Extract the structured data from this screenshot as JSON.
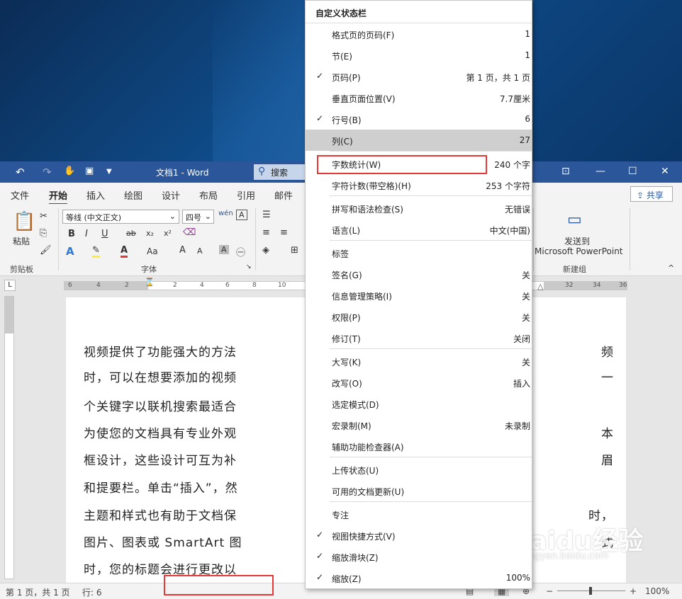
{
  "titlebar": {
    "undo_icon": "undo-icon",
    "redo_icon": "redo-icon",
    "title": "文档1 - Word",
    "search": "搜索"
  },
  "tabs": [
    "文件",
    "开始",
    "插入",
    "绘图",
    "设计",
    "布局",
    "引用",
    "邮件"
  ],
  "share_label": "共享",
  "ribbon": {
    "paste": "粘贴",
    "clipboard": "剪贴板",
    "font_name": "等线 (中文正文)",
    "font_size": "四号",
    "font_group": "字体",
    "bold": "B",
    "italic": "I",
    "underline": "U",
    "strike": "ab",
    "sub": "x₂",
    "sup": "x²",
    "aa": "Aa",
    "grow": "A^",
    "shrink": "A˅",
    "send_line1": "发送到",
    "send_line2": "Microsoft PowerPoint",
    "new_group": "新建组"
  },
  "ruler": {
    "left": [
      "6",
      "4",
      "2"
    ],
    "mid": [
      "2",
      "4",
      "6",
      "8",
      "10"
    ],
    "right": [
      "32",
      "34",
      "36"
    ],
    "corner": "L"
  },
  "document": {
    "lines": [
      "视频提供了功能强大的方法",
      "时，可以在想要添加的视频",
      "个关键字以联机搜索最适合",
      "为使您的文档具有专业外观",
      "框设计，这些设计可互为补",
      "和提要栏。单击“插入”，然",
      "主题和样式也有助于文档保",
      "图片、图表或 SmartArt 图",
      "时，您的标题会进行更改以"
    ],
    "right_frags": [
      "频",
      "一",
      "",
      "本",
      "眉",
      "",
      "时，",
      "式",
      ""
    ]
  },
  "status": {
    "page": "第 1 页，共 1 页",
    "line": "行: 6",
    "zoom": "100%",
    "minus": "−",
    "plus": "+"
  },
  "menu": {
    "title": "自定义状态栏",
    "items": [
      {
        "label": "格式页的页码(F)",
        "value": "1",
        "checked": ""
      },
      {
        "label": "节(E)",
        "value": "1",
        "checked": ""
      },
      {
        "label": "页码(P)",
        "value": "第 1 页，共 1 页",
        "checked": "✓"
      },
      {
        "label": "垂直页面位置(V)",
        "value": "7.7厘米",
        "checked": ""
      },
      {
        "label": "行号(B)",
        "value": "6",
        "checked": "✓"
      },
      {
        "label": "列(C)",
        "value": "27",
        "checked": ""
      },
      {
        "label": "字数统计(W)",
        "value": "240 个字",
        "checked": ""
      },
      {
        "label": "字符计数(带空格)(H)",
        "value": "253 个字符",
        "checked": ""
      },
      {
        "label": "拼写和语法检查(S)",
        "value": "无错误",
        "checked": ""
      },
      {
        "label": "语言(L)",
        "value": "中文(中国)",
        "checked": ""
      },
      {
        "label": "标签",
        "value": "",
        "checked": ""
      },
      {
        "label": "签名(G)",
        "value": "关",
        "checked": ""
      },
      {
        "label": "信息管理策略(I)",
        "value": "关",
        "checked": ""
      },
      {
        "label": "权限(P)",
        "value": "关",
        "checked": ""
      },
      {
        "label": "修订(T)",
        "value": "关闭",
        "checked": ""
      },
      {
        "label": "大写(K)",
        "value": "关",
        "checked": ""
      },
      {
        "label": "改写(O)",
        "value": "插入",
        "checked": ""
      },
      {
        "label": "选定模式(D)",
        "value": "",
        "checked": ""
      },
      {
        "label": "宏录制(M)",
        "value": "未录制",
        "checked": ""
      },
      {
        "label": "辅助功能检查器(A)",
        "value": "",
        "checked": ""
      },
      {
        "label": "上传状态(U)",
        "value": "",
        "checked": ""
      },
      {
        "label": "可用的文档更新(U)",
        "value": "",
        "checked": ""
      },
      {
        "label": "专注",
        "value": "",
        "checked": ""
      },
      {
        "label": "视图快捷方式(V)",
        "value": "",
        "checked": "✓"
      },
      {
        "label": "缩放滑块(Z)",
        "value": "",
        "checked": "✓"
      },
      {
        "label": "缩放(Z)",
        "value": "100%",
        "checked": "✓"
      }
    ]
  },
  "watermark": {
    "big": "Baidu经验",
    "small": "jingyan.baidu.com"
  },
  "colors": {
    "word_blue": "#2b579a",
    "highlight": "#cfcfcf",
    "annotation": "#e53935"
  }
}
